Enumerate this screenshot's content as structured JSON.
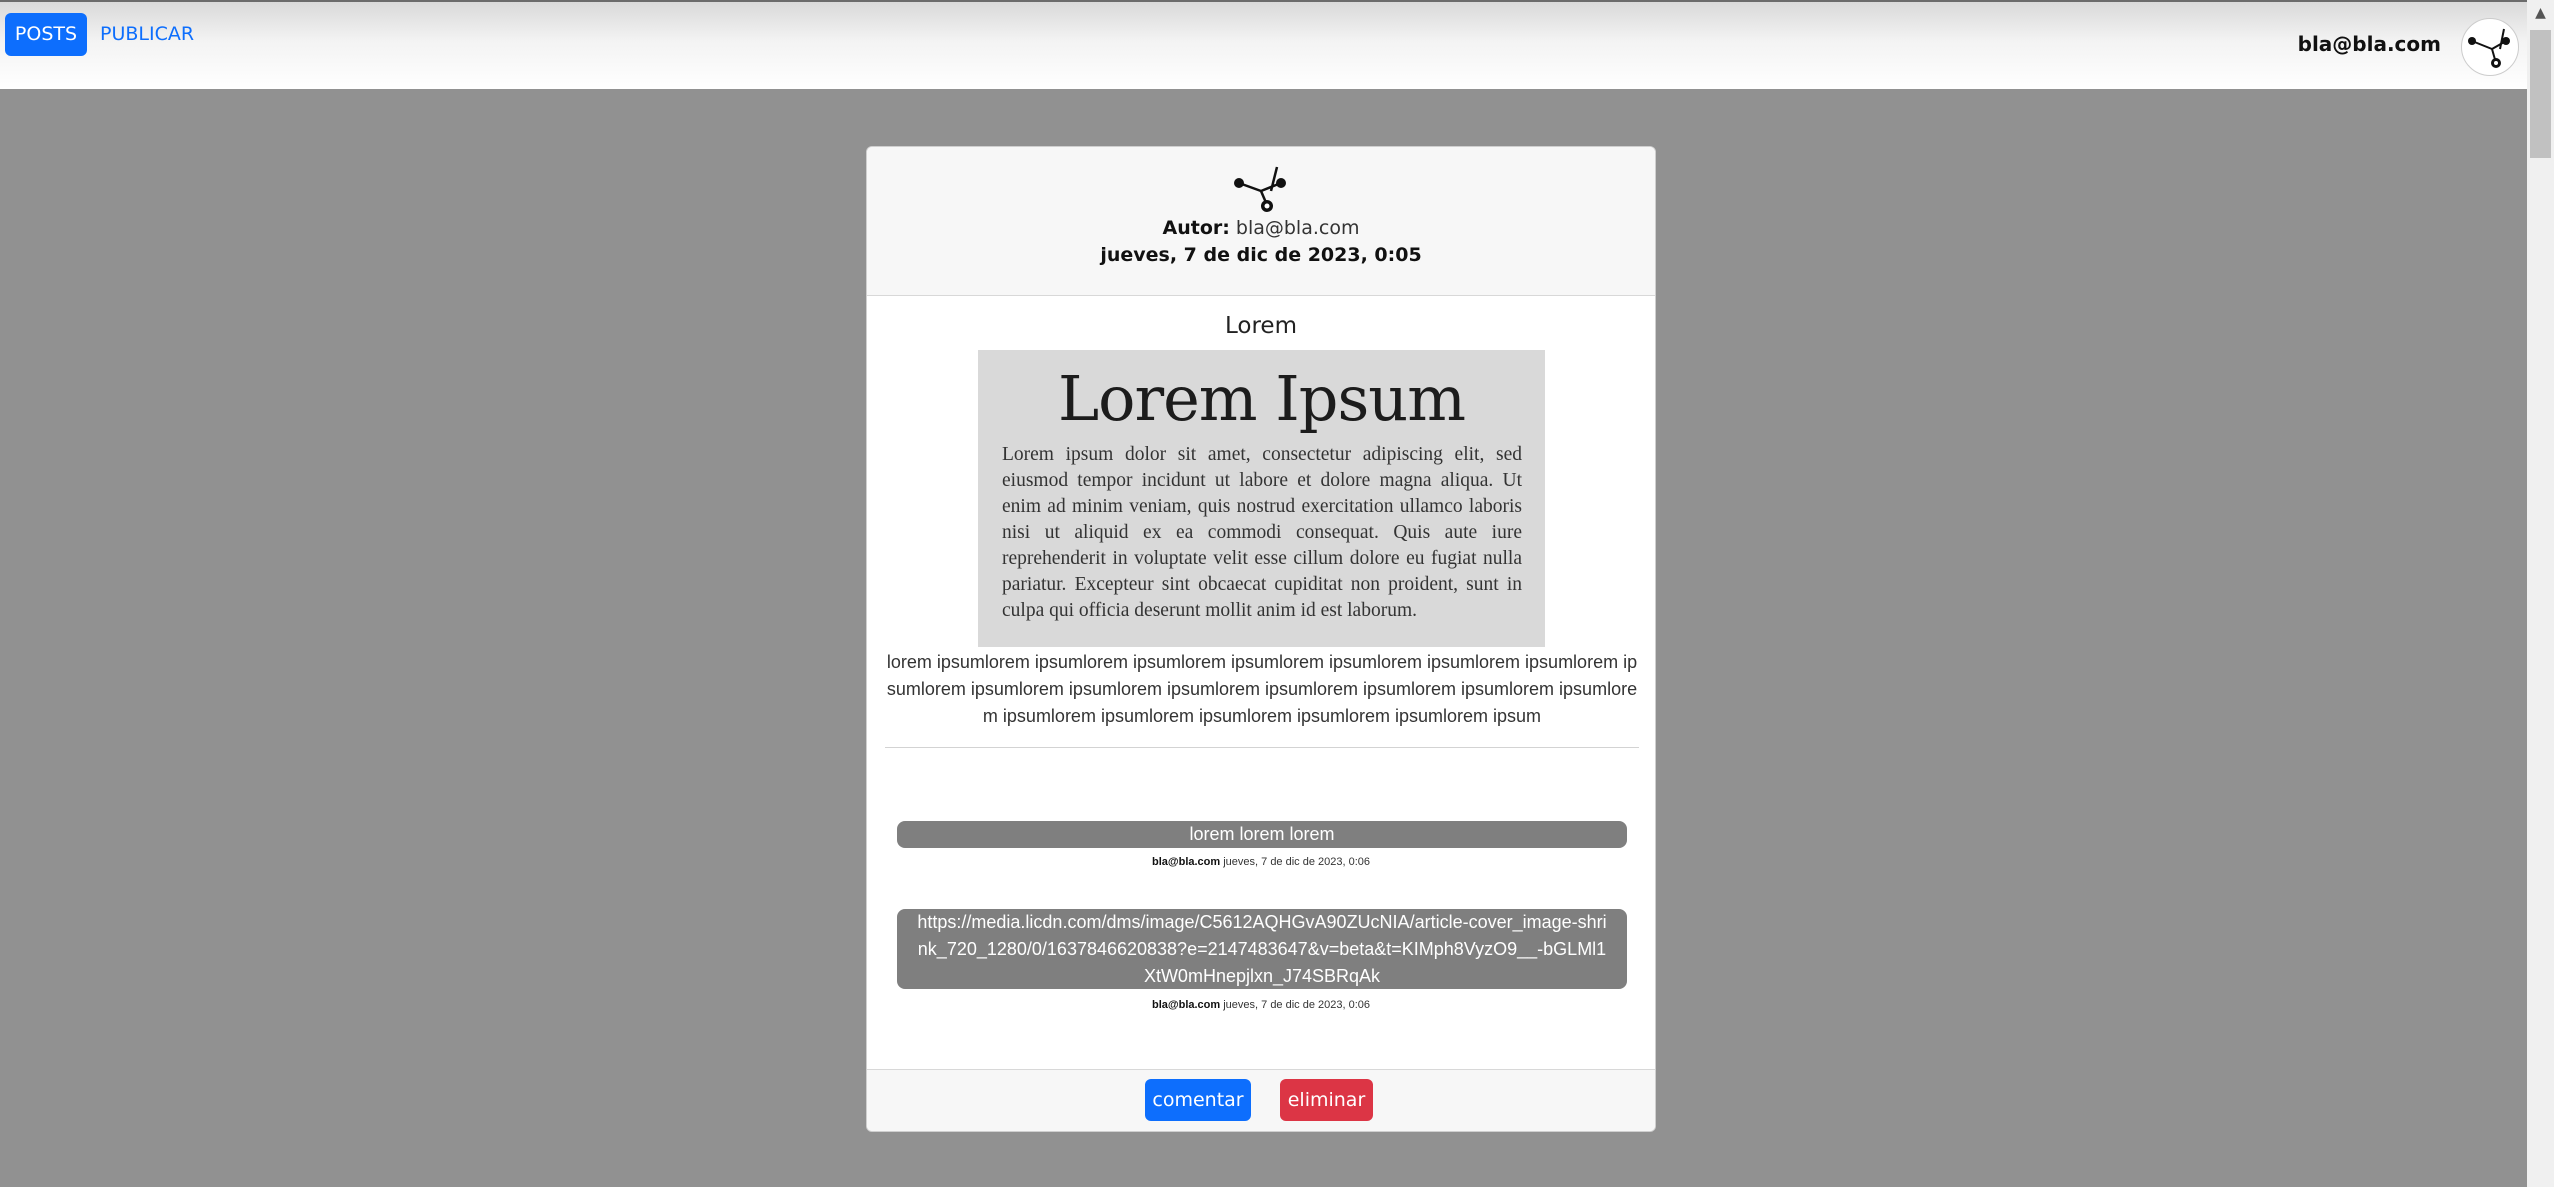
{
  "navbar": {
    "posts_label": "POSTS",
    "publicar_label": "PUBLICAR",
    "user_email": "bla@bla.com"
  },
  "post": {
    "author_label": "Autor:",
    "author_email": "bla@bla.com",
    "date": "jueves, 7 de dic de 2023, 0:05",
    "title": "Lorem",
    "image_heading": "Lorem Ipsum",
    "image_text": "Lorem ipsum dolor sit amet, consectetur adipiscing elit, sed eiusmod tempor incidunt ut labore et dolore magna aliqua. Ut enim ad minim veniam, quis nostrud exercitation ullamco laboris nisi ut aliquid ex ea commodi consequat. Quis aute iure reprehenderit in voluptate velit esse cillum dolore eu fugiat nulla pariatur. Excepteur sint obcaecat cupiditat non proident, sunt in culpa qui officia deserunt mollit anim id est laborum.",
    "body": "lorem ipsumlorem ipsumlorem ipsumlorem ipsumlorem ipsumlorem ipsumlorem ipsumlorem ipsumlorem ipsumlorem ipsumlorem ipsumlorem ipsumlorem ipsumlorem ipsumlorem ipsumlorem ipsumlorem ipsumlorem ipsumlorem ipsumlorem ipsumlorem ipsum"
  },
  "comments": [
    {
      "text": "lorem lorem lorem",
      "author": "bla@bla.com",
      "date": "jueves, 7 de dic de 2023, 0:06"
    },
    {
      "text": "https://media.licdn.com/dms/image/C5612AQHGvA90ZUcNIA/article-cover_image-shrink_720_1280/0/1637846620838?e=2147483647&v=beta&t=KIMph8VyzO9__-bGLMl1XtW0mHnepjlxn_J74SBRqAk",
      "author": "bla@bla.com",
      "date": "jueves, 7 de dic de 2023, 0:06"
    }
  ],
  "actions": {
    "comentar_label": "comentar",
    "eliminar_label": "eliminar"
  },
  "colors": {
    "primary": "#0d6efd",
    "danger": "#dc3545",
    "comment_bg": "#7f7f7f",
    "page_bg": "#919191"
  }
}
